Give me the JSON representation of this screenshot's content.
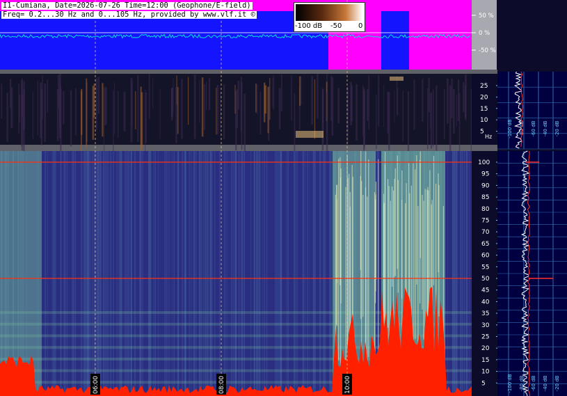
{
  "header": {
    "line1": "I1-Cumiana, Date=2026-07-26 Time=12:00 (Geophone/E-field)",
    "line2": "Freq= 0.2...30 Hz and 0...105 Hz, provided by www.vlf.it ©"
  },
  "colorbar": {
    "labels": [
      "-100 dB",
      "-50",
      "0"
    ]
  },
  "chart_data": [
    {
      "type": "area",
      "panel": "amplitude",
      "ticks": [
        "50 %",
        "0 %",
        "-50 %"
      ],
      "colors": {
        "background": "#ff00ff",
        "fill": "#1414ff",
        "trace": "#00e0e0"
      }
    },
    {
      "type": "heatmap",
      "panel": "spectrogram-low",
      "yticks": [
        25,
        20,
        15,
        10,
        5
      ],
      "yunit": "Hz",
      "colormap": [
        "#141428",
        "#3a2a50",
        "#a06030",
        "#ffd080"
      ]
    },
    {
      "type": "heatmap",
      "panel": "spectrogram-high",
      "yticks": [
        100,
        95,
        90,
        85,
        80,
        75,
        70,
        65,
        60,
        55,
        50,
        45,
        40,
        35,
        30,
        25,
        20,
        15,
        10,
        5
      ],
      "xticks": [
        "06:00",
        "08:00",
        "10:00"
      ],
      "lines_hz": [
        50,
        100
      ],
      "colormap": [
        "#2a2e80",
        "#4a70a8",
        "#7ac8a0",
        "#e8f0c0",
        "#ff2000"
      ]
    },
    {
      "type": "line",
      "panel": "spectrum-low",
      "xticks": [
        "-100 dB",
        "-80 dB",
        "-60 dB",
        "-40 dB",
        "-20 dB"
      ]
    },
    {
      "type": "line",
      "panel": "spectrum-high",
      "xticks": [
        "-100 dB",
        "-80 dB",
        "-60 dB",
        "-40 dB",
        "-20 dB"
      ]
    }
  ]
}
